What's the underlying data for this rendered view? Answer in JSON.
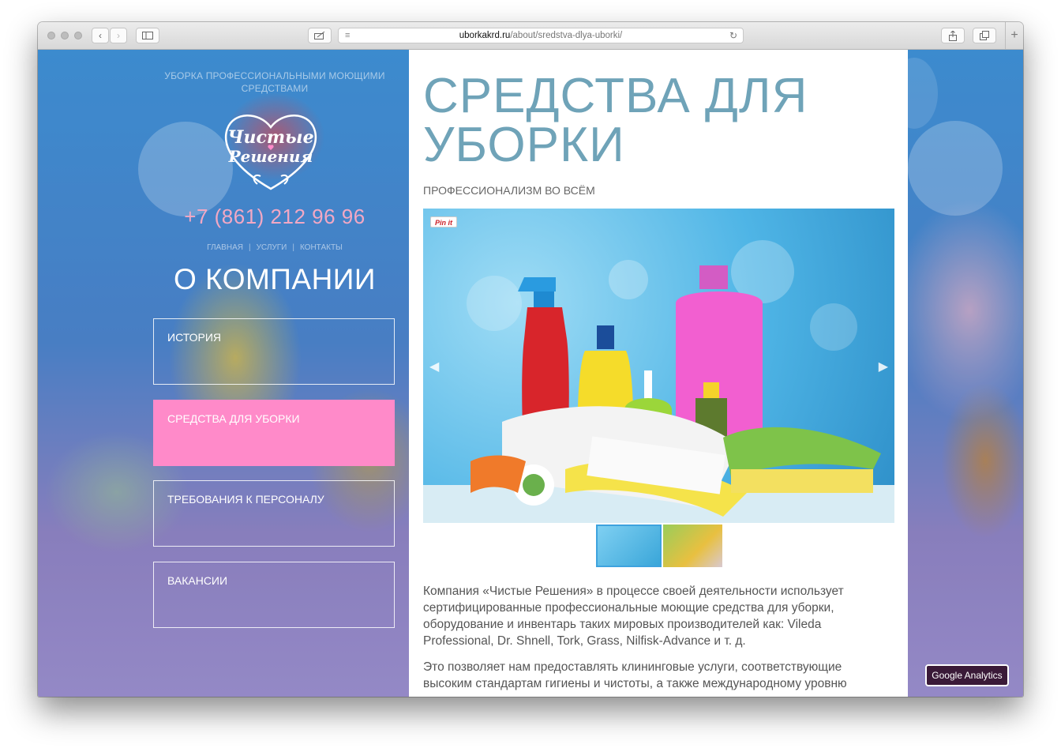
{
  "browser": {
    "url_host": "uborkakrd.ru",
    "url_path": "/about/sredstva-dlya-uborki/"
  },
  "sidebar": {
    "tagline": "УБОРКА ПРОФЕССИОНАЛЬНЫМИ МОЮЩИМИ СРЕДСТВАМИ",
    "logo_line1": "Чистые",
    "logo_line2": "Решения",
    "phone": "+7 (861) 212 96 96",
    "nav": [
      "ГЛАВНАЯ",
      "УСЛУГИ",
      "КОНТАКТЫ"
    ],
    "nav_separator": "|",
    "section_title": "О КОМПАНИИ",
    "menu": [
      {
        "label": "ИСТОРИЯ",
        "active": false
      },
      {
        "label": "СРЕДСТВА ДЛЯ УБОРКИ",
        "active": true
      },
      {
        "label": "ТРЕБОВАНИЯ К ПЕРСОНАЛУ",
        "active": false
      },
      {
        "label": "ВАКАНСИИ",
        "active": false
      }
    ],
    "active_color": "#ff8ac9"
  },
  "content": {
    "title": "СРЕДСТВА ДЛЯ УБОРКИ",
    "subtitle": "ПРОФЕССИОНАЛИЗМ ВО ВСЁМ",
    "pinit_label": "Pin it",
    "paragraphs": [
      "Компания «Чистые Решения» в процессе своей деятельности использует сертифицированные профессиональные моющие средства для уборки, оборудование и инвентарь таких мировых производителей как: Vileda Professional, Dr. Shnell, Tork, Grass, Nilfisk-Advance и т. д.",
      "Это позволяет нам предоставлять клининговые услуги, соответствующие высоким стандартам гигиены и чистоты, а также международному уровню"
    ],
    "title_color": "#6fa3b8"
  },
  "badge": {
    "label": "Google Analytics"
  }
}
